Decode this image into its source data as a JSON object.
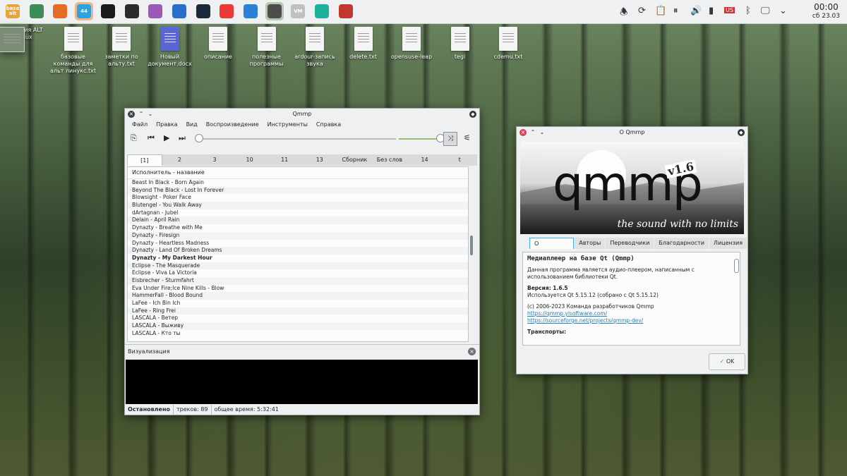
{
  "panel": {
    "launchers": [
      {
        "name": "alt-base-icon",
        "label": "base alt"
      },
      {
        "name": "file-manager-icon",
        "label": ""
      },
      {
        "name": "firefox-icon",
        "label": ""
      },
      {
        "name": "telegram-icon",
        "label": "44"
      },
      {
        "name": "clover-icon",
        "label": ""
      },
      {
        "name": "obs-icon",
        "label": ""
      },
      {
        "name": "colorwheel-icon",
        "label": ""
      },
      {
        "name": "davinci-icon",
        "label": ""
      },
      {
        "name": "steam-icon",
        "label": ""
      },
      {
        "name": "vivaldi-icon",
        "label": ""
      },
      {
        "name": "qbittorrent-icon",
        "label": ""
      },
      {
        "name": "qmmp-icon",
        "label": ""
      },
      {
        "name": "vm-icon",
        "label": "VM"
      },
      {
        "name": "chat-icon",
        "label": ""
      },
      {
        "name": "radio-icon",
        "label": ""
      }
    ],
    "keyboard_layout": "US",
    "clock_time": "00:00",
    "clock_date": "сб 23.03"
  },
  "desktop": {
    "icons": [
      {
        "label": "История ALT Linux",
        "type": "win"
      },
      {
        "label": "базовые команды для альт линукс.txt",
        "type": "txt"
      },
      {
        "label": "заметки по альту.txt",
        "type": "txt"
      },
      {
        "label": "Новый документ.docx",
        "type": "docx"
      },
      {
        "label": "описание",
        "type": "txt"
      },
      {
        "label": "полезные программы",
        "type": "txt"
      },
      {
        "label": "ardour-запись звука",
        "type": "txt"
      },
      {
        "label": "delete.txt",
        "type": "txt"
      },
      {
        "label": "opensuse-leap",
        "type": "txt"
      },
      {
        "label": "tegi",
        "type": "txt"
      },
      {
        "label": "cdemu.txt",
        "type": "txt"
      }
    ]
  },
  "qmmp": {
    "title": "Qmmp",
    "menu": [
      "Файл",
      "Правка",
      "Вид",
      "Воспроизведение",
      "Инструменты",
      "Справка"
    ],
    "seek_fraction": 0.0,
    "volume_fraction": 1.0,
    "tabs": [
      "[1]",
      "2",
      "3",
      "10",
      "11",
      "13",
      "Сборник",
      "Без слов",
      "14",
      "t"
    ],
    "selected_tab": 0,
    "column_header": "Исполнитель - название",
    "tracks": [
      "Beast In Black - Born Again",
      "Beyond The Black - Lost In Forever",
      "Blowsight - Poker Face",
      "Blutengel - You Walk Away",
      "dArtagnan - Jubel",
      "Delain - April Rain",
      "Dynazty - Breathe with Me",
      "Dynazty - Firesign",
      "Dynazty - Heartless Madness",
      "Dynazty - Land Of Broken Dreams",
      "Dynazty - My Darkest Hour",
      "Eclipse - The Masquerade",
      "Eclipse - Viva La Victoria",
      "Eisbrecher - Sturmfahrt",
      "Eva Under Fire;Ice Nine Kills - Blow",
      "HammerFall - Blood Bound",
      "LaFee - Ich Bin Ich",
      "LaFee - Ring Frei",
      "LASCALA - Ветер",
      "LASCALA - Выживу",
      "LASCALA - Кто ты"
    ],
    "current_track_index": 10,
    "viz_title": "Визуализация",
    "status": {
      "state": "Остановлено",
      "tracks": "треков: 89",
      "total": "общее время: 5:32:41"
    }
  },
  "about": {
    "title": "О Qmmp",
    "banner_logo": "qmmp",
    "banner_version": "v1.6",
    "banner_tagline": "the sound with no limits",
    "tabs": [
      "О программе",
      "Авторы",
      "Переводчики",
      "Благодарности",
      "Лицензия"
    ],
    "selected_tab": 0,
    "heading": "Медиаплеер на базе Qt (Qmmp)",
    "desc_line1": "Данная программа является аудио-плеером, написанным с",
    "desc_line2": "использованием библиотеки Qt.",
    "version_label": "Версия: 1.6.5",
    "qt_line": "Используется Qt 5.15.12 (собрано с Qt 5.15.12)",
    "copyright": "(c) 2006-2023 Команда разработчиков Qmmp",
    "link1": "https://qmmp.ylsoftware.com/",
    "link2": "https://sourceforge.net/projects/qmmp-dev/",
    "transports": "Транспорты:",
    "ok_label": "OK"
  }
}
